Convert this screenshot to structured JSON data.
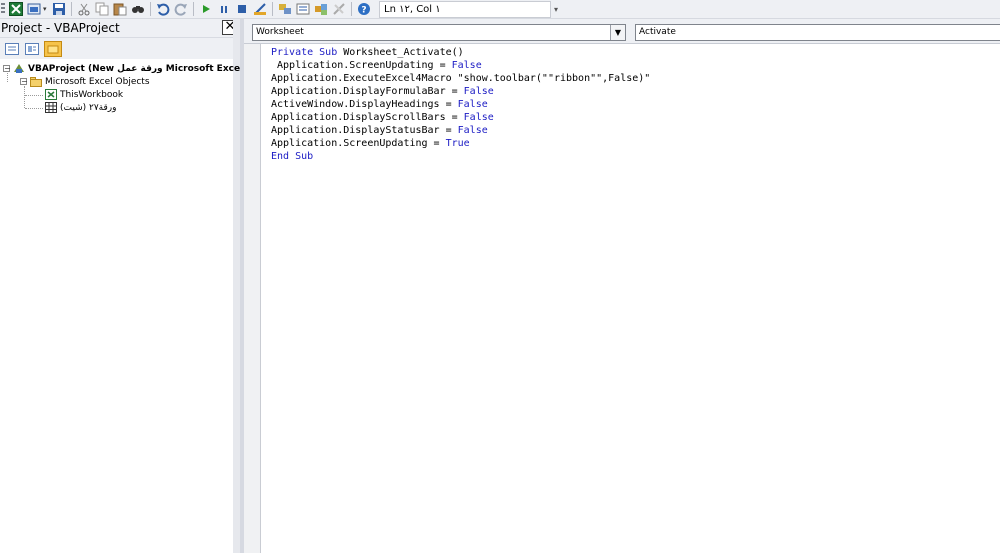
{
  "toolbar": {
    "buttons": [
      "excel-view-icon",
      "insert-module-icon",
      "save-icon",
      "cut-icon",
      "copy-icon",
      "paste-icon",
      "find-icon",
      "undo-icon",
      "redo-icon",
      "run-icon",
      "break-icon",
      "reset-icon",
      "design-mode-icon",
      "project-explorer-icon",
      "properties-icon",
      "object-browser-icon",
      "toolbox-icon",
      "help-icon"
    ],
    "position_label": "Ln ١٢, Col ١"
  },
  "project_pane": {
    "title": "Project - VBAProject",
    "close_label": "✕",
    "tree": {
      "project": "VBAProject (New ورقة عمل Microsoft Excel.xls",
      "folder": "Microsoft Excel Objects",
      "items": [
        "ThisWorkbook",
        "ورقة٢٧ (شيت)"
      ]
    }
  },
  "code_window": {
    "object_combo": "Worksheet",
    "procedure_combo": "Activate",
    "code_lines": [
      [
        {
          "t": "Private Sub ",
          "k": true
        },
        {
          "t": "Worksheet_Activate()"
        }
      ],
      [
        {
          "t": " Application.ScreenUpdating = "
        },
        {
          "t": "False",
          "k": true
        }
      ],
      [
        {
          "t": "Application.ExecuteExcel4Macro \"show.toolbar(\"\"ribbon\"\",False)\""
        }
      ],
      [
        {
          "t": "Application.DisplayFormulaBar = "
        },
        {
          "t": "False",
          "k": true
        }
      ],
      [
        {
          "t": "ActiveWindow.DisplayHeadings = "
        },
        {
          "t": "False",
          "k": true
        }
      ],
      [
        {
          "t": "Application.DisplayScrollBars = "
        },
        {
          "t": "False",
          "k": true
        }
      ],
      [
        {
          "t": "Application.DisplayStatusBar = "
        },
        {
          "t": "False",
          "k": true
        }
      ],
      [
        {
          "t": "Application.ScreenUpdating = "
        },
        {
          "t": "True",
          "k": true
        }
      ],
      [
        {
          "t": "End Sub",
          "k": true
        }
      ]
    ]
  },
  "colors": {
    "keyword": "#1c1cc4",
    "chrome": "#eef0f4"
  }
}
